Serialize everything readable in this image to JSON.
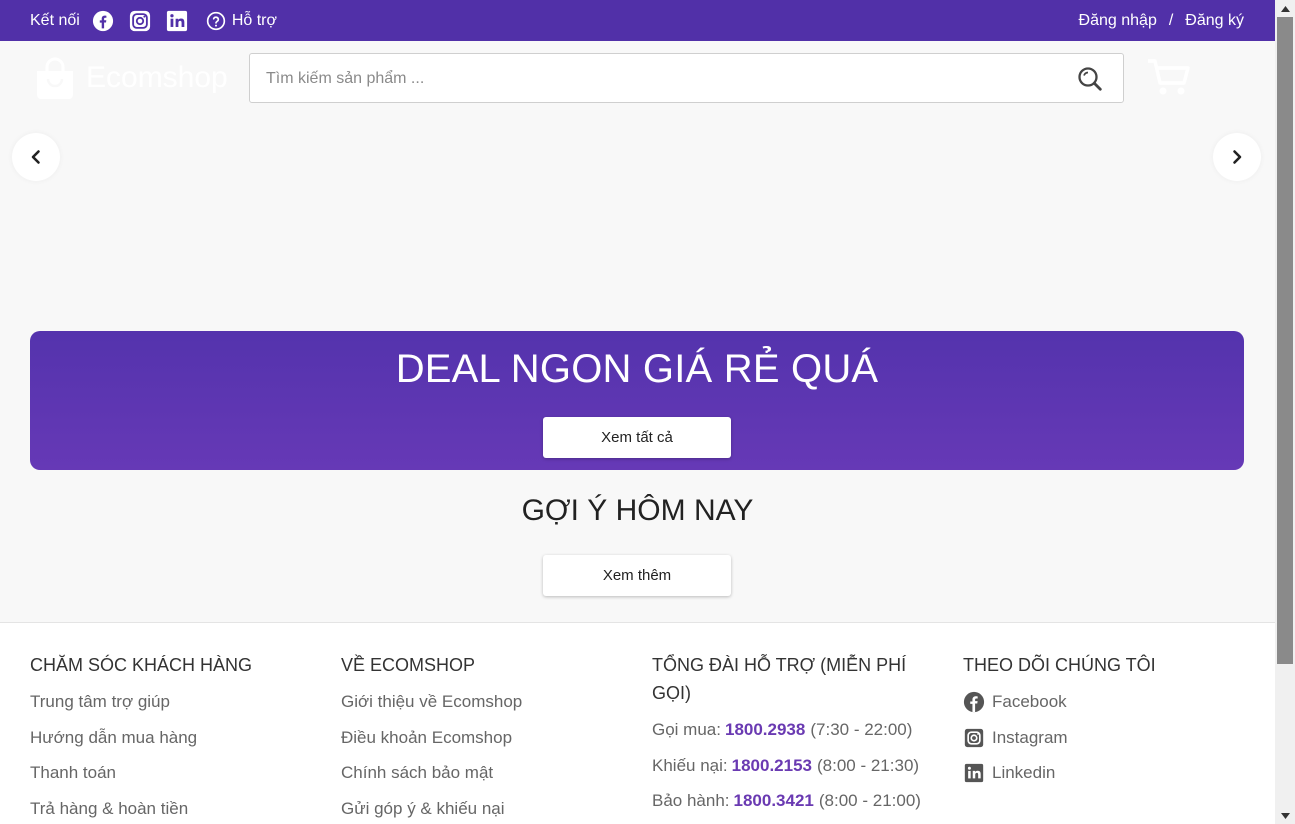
{
  "topbar": {
    "connect_label": "Kết nối",
    "social_icons": [
      "facebook-icon",
      "instagram-icon",
      "linkedin-icon"
    ],
    "help_label": "Hỗ trợ",
    "login_label": "Đăng nhập",
    "separator": "/",
    "register_label": "Đăng ký"
  },
  "header": {
    "logo_text": "Ecomshop",
    "search": {
      "placeholder": "Tìm kiếm sản phẩm ...",
      "value": ""
    }
  },
  "deal": {
    "title": "DEAL NGON GIÁ RẺ QUÁ",
    "button_label": "Xem tất cả"
  },
  "suggest": {
    "title": "GỢI Ý HÔM NAY",
    "button_label": "Xem thêm"
  },
  "footer": {
    "customer_care": {
      "title": "CHĂM SÓC KHÁCH HÀNG",
      "items": [
        "Trung tâm trợ giúp",
        "Hướng dẫn mua hàng",
        "Thanh toán",
        "Trả hàng & hoàn tiền"
      ]
    },
    "about": {
      "title": "VỀ ECOMSHOP",
      "items": [
        "Giới thiệu về Ecomshop",
        "Điều khoản Ecomshop",
        "Chính sách bảo mật",
        "Gửi góp ý & khiếu nại"
      ]
    },
    "hotline": {
      "title": "TỔNG ĐÀI HỖ TRỢ (MIỄN PHÍ GỌI)",
      "lines": [
        {
          "label": "Gọi mua:",
          "number": "1800.2938",
          "hours": "(7:30 - 22:00)"
        },
        {
          "label": "Khiếu nại:",
          "number": "1800.2153",
          "hours": "(8:00 - 21:30)"
        },
        {
          "label": "Bảo hành:",
          "number": "1800.3421",
          "hours": "(8:00 - 21:00)"
        }
      ]
    },
    "follow": {
      "title": "THEO DÕI CHÚNG TÔI",
      "items": [
        {
          "label": "Facebook",
          "icon": "facebook-icon"
        },
        {
          "label": "Instagram",
          "icon": "instagram-icon"
        },
        {
          "label": "Linkedin",
          "icon": "linkedin-icon"
        }
      ]
    }
  },
  "colors": {
    "brand": "#5130a8",
    "accent": "#6a3ab2"
  }
}
